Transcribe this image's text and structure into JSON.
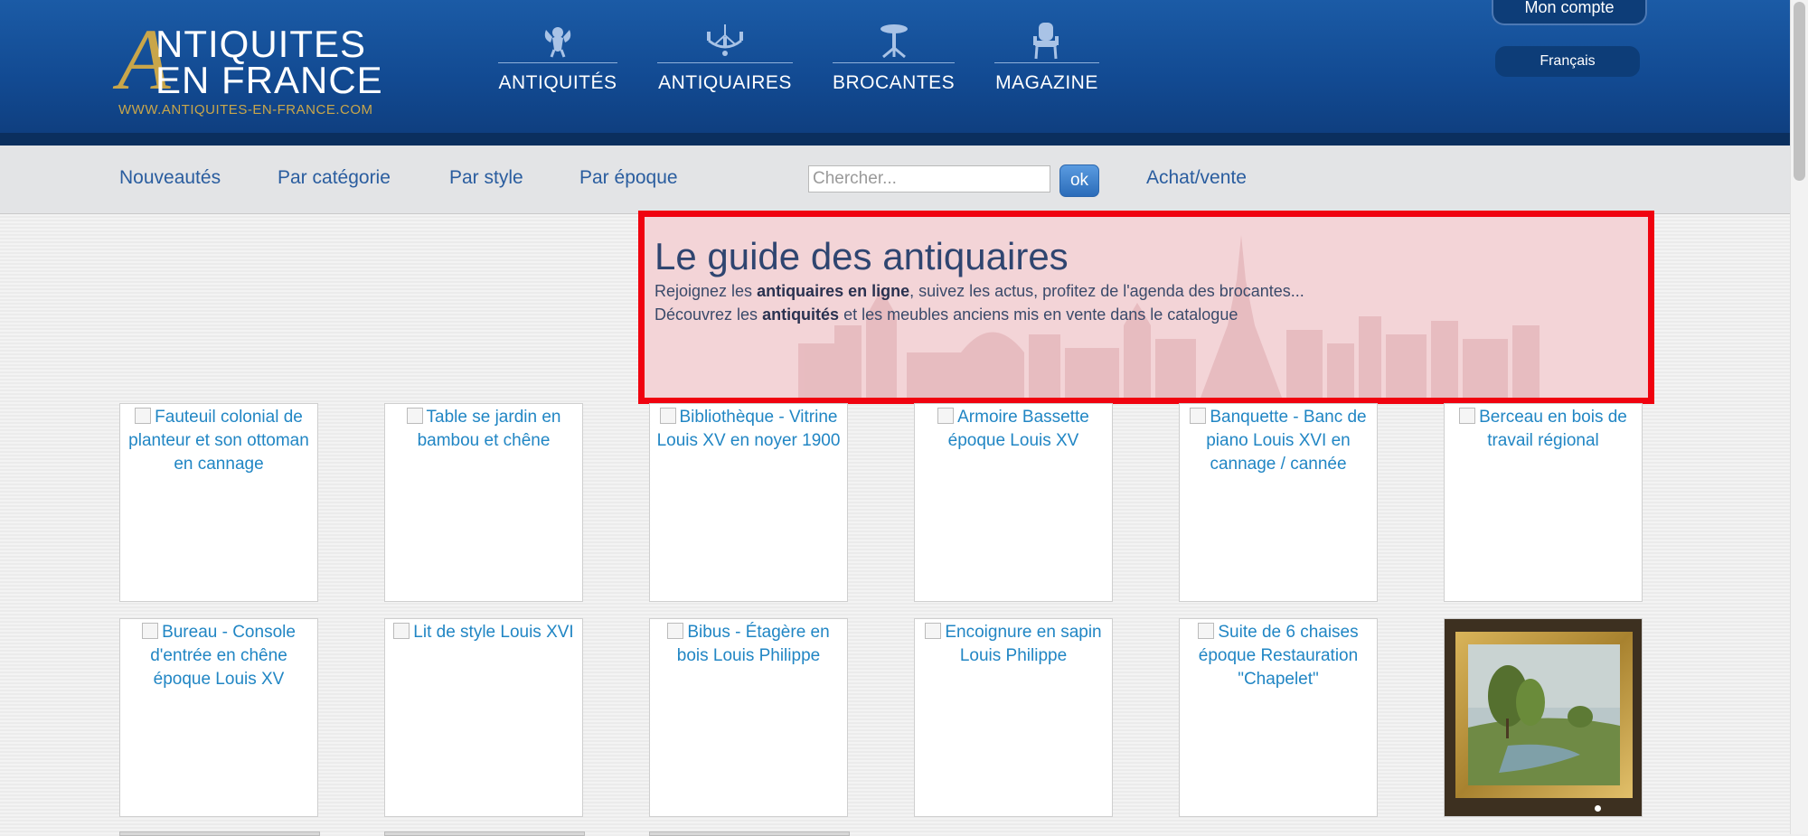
{
  "header": {
    "logo": {
      "letter": "A",
      "line1": "NTIQUITES",
      "line2": "EN FRANCE",
      "url": "WWW.ANTIQUITES-EN-FRANCE.COM"
    },
    "nav": [
      {
        "label": "ANTIQUITÉS",
        "icon": "cherub-icon"
      },
      {
        "label": "ANTIQUAIRES",
        "icon": "chandelier-icon"
      },
      {
        "label": "BROCANTES",
        "icon": "pedestal-table-icon"
      },
      {
        "label": "MAGAZINE",
        "icon": "armchair-icon"
      }
    ],
    "account_label": "Mon compte",
    "language_label": "Français"
  },
  "subnav": {
    "links": [
      "Nouveautés",
      "Par catégorie",
      "Par style",
      "Par époque"
    ],
    "search_placeholder": "Chercher...",
    "search_value": "",
    "search_button": "ok",
    "trade_link": "Achat/vente"
  },
  "guide": {
    "title": "Le guide des antiquaires",
    "line1_pre": "Rejoignez les ",
    "line1_bold": "antiquaires en ligne",
    "line1_post": ", suivez les actus, profitez de l'agenda des brocantes...",
    "line2_pre": "Découvrez les ",
    "line2_bold": "antiquités",
    "line2_post": " et les meubles anciens mis en vente dans le catalogue"
  },
  "products": {
    "row1": [
      "Fauteuil colonial de planteur et son ottoman en cannage",
      "Table se jardin en bambou et chêne",
      "Bibliothèque - Vitrine Louis XV en noyer 1900",
      "Armoire Bassette époque Louis XV",
      "Banquette - Banc de piano Louis XVI en cannage / cannée",
      "Berceau en bois de travail régional"
    ],
    "row2": [
      "Bureau - Console d'entrée en chêne époque Louis XV",
      "Lit de style Louis XVI",
      "Bibus - Étagère en bois Louis Philippe",
      "Encoignure en sapin Louis Philippe",
      "Suite de 6 chaises époque Restauration \"Chapelet\""
    ]
  },
  "colors": {
    "header_blue": "#1b5ba6",
    "link_blue": "#2a5d9f",
    "alt_text_blue": "#2186c4",
    "gold": "#c9a64a",
    "highlight_red": "#f0020f"
  }
}
